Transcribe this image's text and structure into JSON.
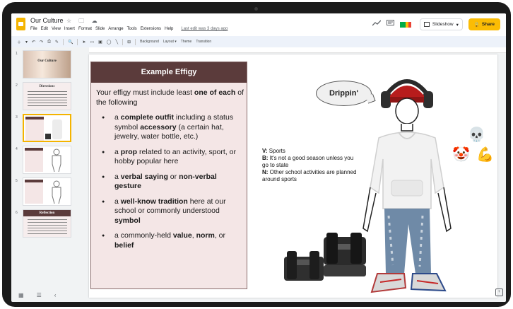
{
  "app": {
    "doc_title": "Our Culture",
    "title_icons": "☆ 🗀 ☁",
    "menu": [
      "File",
      "Edit",
      "View",
      "Insert",
      "Format",
      "Slide",
      "Arrange",
      "Tools",
      "Extensions",
      "Help"
    ],
    "last_edit": "Last edit was 3 days ago",
    "slideshow_label": "Slideshow",
    "share_label": "Share"
  },
  "toolbar": {
    "background_label": "Background",
    "layout_label": "Layout ▾",
    "theme_label": "Theme",
    "transition_label": "Transition"
  },
  "filmstrip": {
    "slides": [
      {
        "num": "1",
        "label": "Our Culture"
      },
      {
        "num": "2",
        "label": "Directions"
      },
      {
        "num": "3",
        "label": ""
      },
      {
        "num": "4",
        "label": ""
      },
      {
        "num": "5",
        "label": ""
      },
      {
        "num": "6",
        "label": "Reflection"
      }
    ],
    "selected_index": 2
  },
  "slide": {
    "box_title": "Example Effigy",
    "intro_plain": "Your effigy must include least ",
    "intro_bold": "one of each",
    "intro_rest": " of the following",
    "bullets": [
      {
        "a": "a ",
        "b1": "complete outfit",
        "c": " including a status symbol ",
        "b2": "accessory",
        "d": " (a certain hat, jewelry, water bottle, etc.)"
      },
      {
        "a": "a ",
        "b1": "prop",
        "c": " related to an activity, sport, or hobby popular here",
        "b2": "",
        "d": ""
      },
      {
        "a": "a ",
        "b1": "verbal saying",
        "c": " or ",
        "b2": "non-verbal gesture",
        "d": ""
      },
      {
        "a": "a ",
        "b1": "well-know tradition",
        "c": " here at our school or commonly understood ",
        "b2": "symbol",
        "d": ""
      },
      {
        "a": "a commonly-held ",
        "b1": "value",
        "c": ", ",
        "b2": "norm",
        "d": ", or belief"
      }
    ],
    "vbn": [
      {
        "k": "V:",
        "v": " Sports"
      },
      {
        "k": "B:",
        "v": " It's not a good season unless you go to state"
      },
      {
        "k": "N:",
        "v": " Other school activities are planned around sports"
      }
    ],
    "bubble_text": "Drippin'",
    "emojis": {
      "skull": "💀",
      "clown": "🤡",
      "muscle": "💪"
    }
  },
  "colors": {
    "accent": "#fbbc04",
    "effigy_header": "#5b3b3b",
    "effigy_bg": "#f4e6e6"
  }
}
